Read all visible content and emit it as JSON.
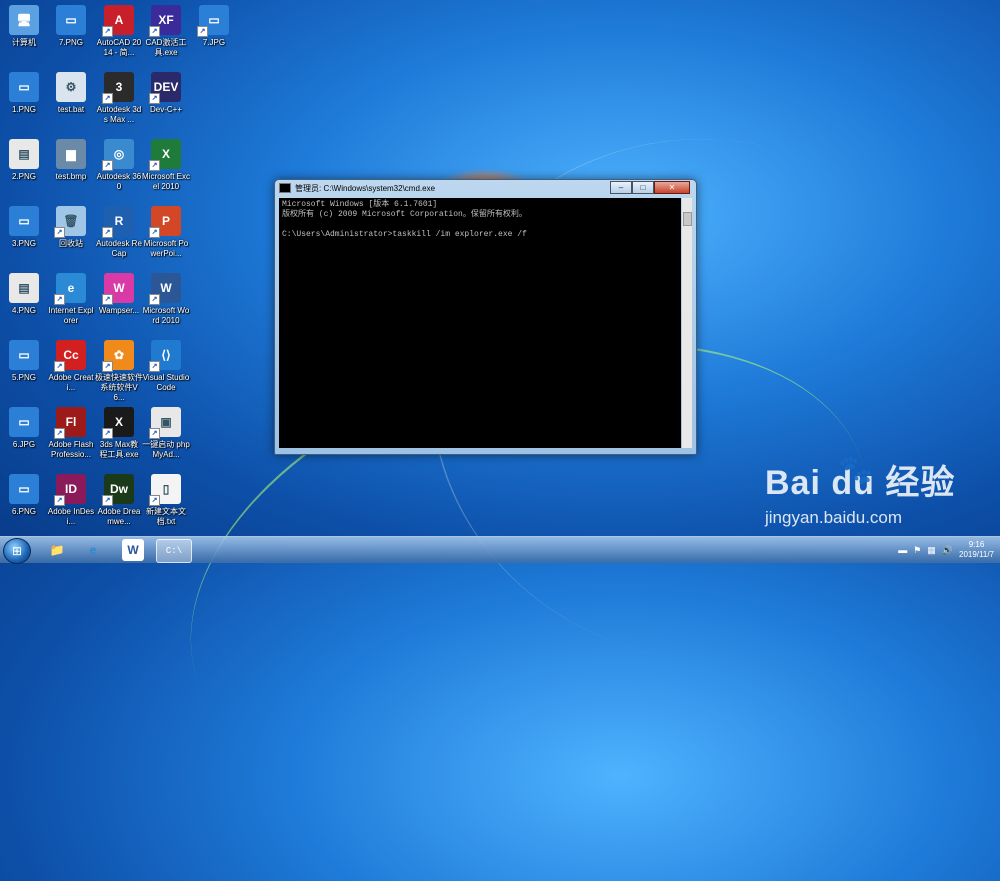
{
  "desktop_icons": [
    {
      "id": "computer",
      "label": "计算机",
      "icon": "computer-icon",
      "color": "#5ba0e0",
      "glyph": "🖥"
    },
    {
      "id": "7png",
      "label": "7.PNG",
      "icon": "image-file-icon",
      "color": "#2c7fd6",
      "glyph": "▭"
    },
    {
      "id": "autocad",
      "label": "AutoCAD 2014 - 简...",
      "icon": "autocad-icon",
      "color": "#c8202a",
      "glyph": "A"
    },
    {
      "id": "cad-crack",
      "label": "CAD激活工具.exe",
      "icon": "cad-activation-icon",
      "color": "#3a2a9a",
      "glyph": "XF"
    },
    {
      "id": "7jpg",
      "label": "7.JPG",
      "icon": "image-file-icon",
      "color": "#2c7fd6",
      "glyph": "▭"
    },
    {
      "id": "1png",
      "label": "1.PNG",
      "icon": "image-file-icon",
      "color": "#2c7fd6",
      "glyph": "▭"
    },
    {
      "id": "testbat",
      "label": "test.bat",
      "icon": "batch-file-icon",
      "color": "#d9e4ef",
      "glyph": "⚙"
    },
    {
      "id": "3dsmax",
      "label": "Autodesk 3ds Max ...",
      "icon": "3ds-max-icon",
      "color": "#2b2b2b",
      "glyph": "3"
    },
    {
      "id": "devcpp",
      "label": "Dev-C++",
      "icon": "devcpp-icon",
      "color": "#2a2a6a",
      "glyph": "DEV"
    },
    {
      "id": "2png",
      "label": "2.PNG",
      "icon": "image-file-icon",
      "color": "#e8e8e8",
      "glyph": "▤"
    },
    {
      "id": "testbmp",
      "label": "test.bmp",
      "icon": "bitmap-file-icon",
      "color": "#6a8aa8",
      "glyph": "▆"
    },
    {
      "id": "autodesk360",
      "label": "Autodesk 360",
      "icon": "autodesk-360-icon",
      "color": "#3a8ad0",
      "glyph": "◎"
    },
    {
      "id": "excel",
      "label": "Microsoft Excel 2010",
      "icon": "excel-icon",
      "color": "#1e7b3a",
      "glyph": "X"
    },
    {
      "id": "3png",
      "label": "3.PNG",
      "icon": "image-file-icon",
      "color": "#2c7fd6",
      "glyph": "▭"
    },
    {
      "id": "recycle",
      "label": "回收站",
      "icon": "recycle-bin-icon",
      "color": "#9fc6e6",
      "glyph": "🗑"
    },
    {
      "id": "recap",
      "label": "Autodesk ReCap",
      "icon": "recap-icon",
      "color": "#1f5fb0",
      "glyph": "R"
    },
    {
      "id": "powerpoint",
      "label": "Microsoft PowerPoi...",
      "icon": "powerpoint-icon",
      "color": "#d24726",
      "glyph": "P"
    },
    {
      "id": "4png",
      "label": "4.PNG",
      "icon": "image-file-icon",
      "color": "#e8e8e8",
      "glyph": "▤"
    },
    {
      "id": "ie",
      "label": "Internet Explorer",
      "icon": "internet-explorer-icon",
      "color": "#2a8ad6",
      "glyph": "e"
    },
    {
      "id": "wamp",
      "label": "Wampser...",
      "icon": "wampserver-icon",
      "color": "#d93aa6",
      "glyph": "W"
    },
    {
      "id": "word",
      "label": "Microsoft Word 2010",
      "icon": "word-icon",
      "color": "#2b5797",
      "glyph": "W"
    },
    {
      "id": "5png",
      "label": "5.PNG",
      "icon": "image-file-icon",
      "color": "#2c7fd6",
      "glyph": "▭"
    },
    {
      "id": "creative",
      "label": "Adobe Creati...",
      "icon": "creative-cloud-icon",
      "color": "#d22020",
      "glyph": "Cc"
    },
    {
      "id": "tool",
      "label": "极速快速软件 系统软件V6...",
      "icon": "orange-tool-icon",
      "color": "#f08a1a",
      "glyph": "✿"
    },
    {
      "id": "vscode",
      "label": "Visual Studio Code",
      "icon": "vscode-icon",
      "color": "#1f7ad0",
      "glyph": "⟨⟩"
    },
    {
      "id": "6jpg",
      "label": "6.JPG",
      "icon": "image-file-icon",
      "color": "#2c7fd6",
      "glyph": "▭"
    },
    {
      "id": "flash",
      "label": "Adobe Flash Professio...",
      "icon": "adobe-flash-icon",
      "color": "#9c1a1a",
      "glyph": "Fl"
    },
    {
      "id": "3dsmaxtool",
      "label": "3ds Max教 程工具.exe",
      "icon": "3ds-max-tool-icon",
      "color": "#1a1a1a",
      "glyph": "X"
    },
    {
      "id": "phpmyadmin",
      "label": "一键启动 phpMyAd...",
      "icon": "phpmyadmin-icon",
      "color": "#e8e8e8",
      "glyph": "▣"
    },
    {
      "id": "6png",
      "label": "6.PNG",
      "icon": "image-file-icon",
      "color": "#2c7fd6",
      "glyph": "▭"
    },
    {
      "id": "indesign",
      "label": "Adobe InDesi...",
      "icon": "indesign-icon",
      "color": "#8a1a5a",
      "glyph": "ID"
    },
    {
      "id": "dreamweaver",
      "label": "Adobe Dreamwe...",
      "icon": "dreamweaver-icon",
      "color": "#1a3a1a",
      "glyph": "Dw"
    },
    {
      "id": "newtxt",
      "label": "新建文本文 档.txt",
      "icon": "text-file-icon",
      "color": "#f4f4f4",
      "glyph": "▯"
    }
  ],
  "cmd_window": {
    "title": "管理员: C:\\Windows\\system32\\cmd.exe",
    "minimize": "–",
    "maximize": "□",
    "close": "✕",
    "lines": [
      "Microsoft Windows [版本 6.1.7601]",
      "版权所有 (c) 2009 Microsoft Corporation。保留所有权利。",
      "",
      "C:\\Users\\Administrator>taskkill /im explorer.exe /f"
    ]
  },
  "watermark": {
    "logo": "Bai  du 经验",
    "site": "jingyan.baidu.com"
  },
  "taskbar": {
    "start": "⊞",
    "items": [
      {
        "name": "explorer",
        "glyph": "📁"
      },
      {
        "name": "ie",
        "glyph": "e"
      },
      {
        "name": "word",
        "glyph": "W"
      },
      {
        "name": "cmd",
        "glyph": "C:\\"
      }
    ],
    "time": "9:16",
    "date": "2019/11/7"
  },
  "colors": {
    "accent": "#1e7ad8",
    "cmd_bg": "#000000",
    "cmd_text": "#c0c0c0"
  }
}
